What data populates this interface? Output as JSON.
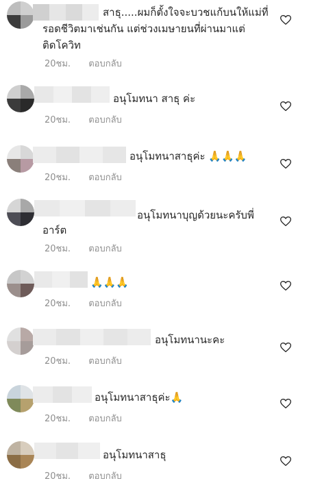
{
  "comments": [
    {
      "lines": [
        "สาธุ.....ผมก็ตั้งใจจะบวชแก้บนให้แม่ที่",
        "รอดชีวิตมาเช่นกัน แต่ช่วงเมษายนที่ผ่านมาแต่",
        "ติดโควิท"
      ],
      "time": "20ชม.",
      "reply": "ตอบกลับ"
    },
    {
      "lines": [
        "อนุโมทนา สาธุ ค่ะ"
      ],
      "time": "20ชม.",
      "reply": "ตอบกลับ"
    },
    {
      "lines": [
        "อนุโมทนาสาธุค่ะ 🙏🙏🙏"
      ],
      "time": "20ชม.",
      "reply": "ตอบกลับ"
    },
    {
      "lines": [
        "อนุโมทนาบุญด้วยนะครับพี่",
        "อาร์ต"
      ],
      "time": "20ชม.",
      "reply": "ตอบกลับ"
    },
    {
      "lines": [
        "🙏🙏🙏"
      ],
      "time": "20ชม.",
      "reply": "ตอบกลับ"
    },
    {
      "lines": [
        "อนุโมทนานะคะ"
      ],
      "time": "20ชม.",
      "reply": "ตอบกลับ"
    },
    {
      "lines": [
        "อนุโมทนาสาธุค่ะ🙏"
      ],
      "time": "20ชม.",
      "reply": "ตอบกลับ"
    },
    {
      "lines": [
        "อนุโมทนาสาธุ"
      ],
      "time": "20ชม.",
      "reply": "ตอบกลับ"
    }
  ],
  "icons": {
    "like": "heart-outline-icon"
  },
  "colors": {
    "meta_text": "#8e8e8e",
    "body_text": "#262626"
  }
}
